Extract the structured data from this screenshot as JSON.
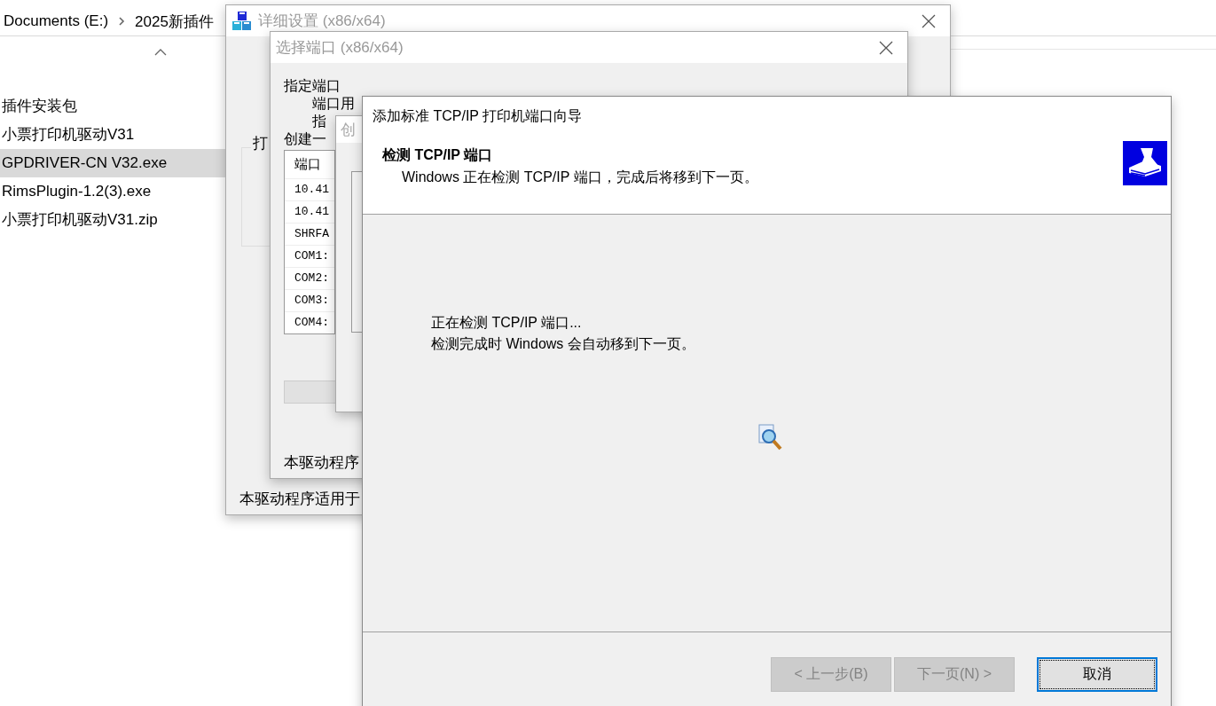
{
  "explorer": {
    "path": [
      {
        "text": "Documents (E:)"
      },
      {
        "text": "2025新插件"
      }
    ],
    "files": [
      {
        "name": "插件安装包",
        "selected": false
      },
      {
        "name": "小票打印机驱动V31",
        "selected": false
      },
      {
        "name": "GPDRIVER-CN V32.exe",
        "selected": true
      },
      {
        "name": "RimsPlugin-1.2(3).exe",
        "selected": false
      },
      {
        "name": "小票打印机驱动V31.zip",
        "selected": false
      }
    ]
  },
  "detail_window": {
    "title": "详细设置 (x86/x64)",
    "group_label": "打",
    "footer": "本驱动程序适用于"
  },
  "port_window": {
    "title": "选择端口 (x86/x64)",
    "heading": "指定端口",
    "line_1": "端口用",
    "line_2": "指",
    "line_3": "创建一",
    "list_header": "端口",
    "ports": [
      "10.41",
      "10.41",
      "SHRFA",
      "COM1:",
      "COM2:",
      "COM3:",
      "COM4:"
    ],
    "footer": "本驱动程序"
  },
  "create_window": {
    "title": "创"
  },
  "wizard": {
    "title": "添加标准 TCP/IP 打印机端口向导",
    "heading": "检测 TCP/IP 端口",
    "subheading": "Windows 正在检测 TCP/IP 端口，完成后将移到下一页。",
    "message": [
      "正在检测 TCP/IP 端口...",
      "检测完成时 Windows 会自动移到下一页。"
    ],
    "buttons": [
      {
        "label": "< 上一步(B)",
        "disabled": true,
        "focused": false
      },
      {
        "label": "下一页(N) >",
        "disabled": true,
        "focused": false
      },
      {
        "label": "取消",
        "disabled": false,
        "focused": true
      }
    ]
  }
}
